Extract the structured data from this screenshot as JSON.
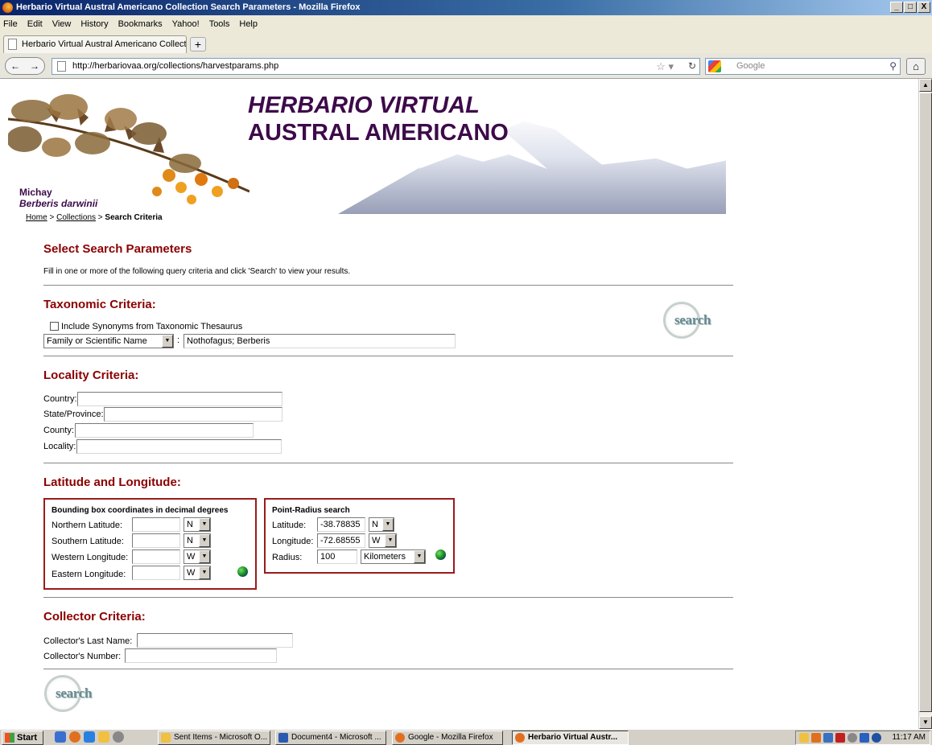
{
  "window": {
    "title": "Herbario Virtual Austral Americano Collection Search Parameters - Mozilla Firefox",
    "controls": [
      "_",
      "□",
      "X"
    ]
  },
  "menu": [
    "File",
    "Edit",
    "View",
    "History",
    "Bookmarks",
    "Yahoo!",
    "Tools",
    "Help"
  ],
  "tabs": [
    {
      "label": "Herbario Virtual Austral Americano Collection..."
    }
  ],
  "nav": {
    "url": "http://herbariovaa.org/collections/harvestparams.php",
    "search_placeholder": "Google"
  },
  "banner": {
    "title_line1": "HERBARIO VIRTUAL",
    "title_line2": "AUSTRAL AMERICANO",
    "plant_common": "Michay",
    "plant_scientific": "Berberis darwinii"
  },
  "breadcrumb": {
    "home": "Home",
    "sep": ">",
    "collections": "Collections",
    "current": "Search Criteria"
  },
  "page": {
    "heading": "Select Search Parameters",
    "intro": "Fill in one or more of the following query criteria and click 'Search' to view your results.",
    "search_button": "search"
  },
  "taxonomic": {
    "heading": "Taxonomic Criteria:",
    "synonyms_label": "Include Synonyms from Taxonomic Thesaurus",
    "synonyms_checked": false,
    "taxon_type": "Family or Scientific Name",
    "colon": ":",
    "taxa_value": "Nothofagus; Berberis"
  },
  "locality": {
    "heading": "Locality Criteria:",
    "country_label": "Country:",
    "state_label": "State/Province:",
    "county_label": "County:",
    "locality_label": "Locality:",
    "country": "",
    "state": "",
    "county": "",
    "locality": ""
  },
  "latlong": {
    "heading": "Latitude and Longitude:",
    "bbox": {
      "title": "Bounding box coordinates in decimal degrees",
      "north_label": "Northern Latitude:",
      "south_label": "Southern Latitude:",
      "west_label": "Western Longitude:",
      "east_label": "Eastern Longitude:",
      "north_dir": "N",
      "south_dir": "N",
      "west_dir": "W",
      "east_dir": "W"
    },
    "point": {
      "title": "Point-Radius search",
      "lat_label": "Latitude:",
      "lng_label": "Longitude:",
      "radius_label": "Radius:",
      "lat": "-38.78835",
      "lat_dir": "N",
      "lng": "-72.68555",
      "lng_dir": "W",
      "radius": "100",
      "radius_unit": "Kilometers"
    }
  },
  "collector": {
    "heading": "Collector Criteria:",
    "lastname_label": "Collector's Last Name:",
    "number_label": "Collector's Number:",
    "lastname": "",
    "number": ""
  },
  "taskbar": {
    "start": "Start",
    "items": [
      {
        "label": "Sent Items - Microsoft O..."
      },
      {
        "label": "Document4 - Microsoft ..."
      },
      {
        "label": "Google - Mozilla Firefox"
      },
      {
        "label": "Herbario Virtual Austr..."
      }
    ],
    "clock": "11:17 AM"
  },
  "colors": {
    "heading": "#8b0000",
    "banner_text": "#3d0a4a",
    "box_border": "#9b1b1b"
  }
}
